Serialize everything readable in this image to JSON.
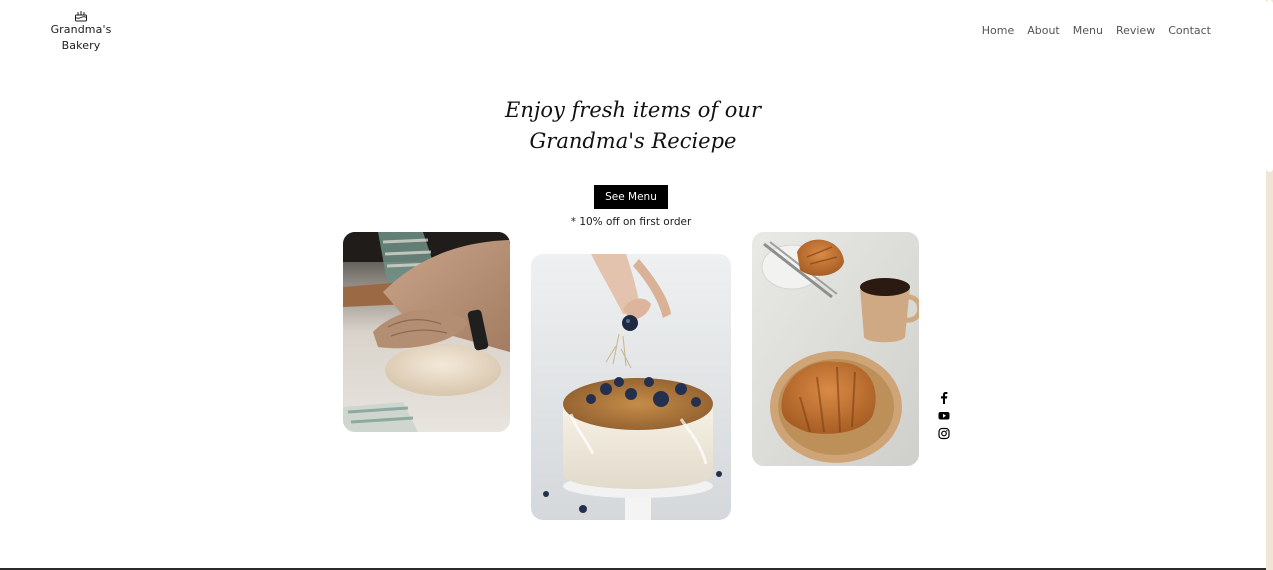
{
  "logo": {
    "icon": "cake-icon",
    "line1": "Grandma's",
    "line2": "Bakery"
  },
  "nav": {
    "items": [
      {
        "label": "Home"
      },
      {
        "label": "About"
      },
      {
        "label": "Menu"
      },
      {
        "label": "Review"
      },
      {
        "label": "Contact"
      }
    ]
  },
  "hero": {
    "title_line1": "Enjoy fresh items of our",
    "title_line2": "Grandma's Reciepe",
    "button_label": "See Menu",
    "promo_note": "* 10% off on first order"
  },
  "gallery": {
    "images": [
      {
        "subject": "hands-kneading-dough"
      },
      {
        "subject": "blueberry-cake"
      },
      {
        "subject": "croissants-and-coffee"
      }
    ]
  },
  "social": {
    "icons": [
      "facebook-icon",
      "youtube-icon",
      "instagram-icon"
    ]
  },
  "colors": {
    "text": "#111111",
    "nav_text": "#555555",
    "button_bg": "#000000",
    "button_text": "#ffffff",
    "background": "#ffffff"
  }
}
